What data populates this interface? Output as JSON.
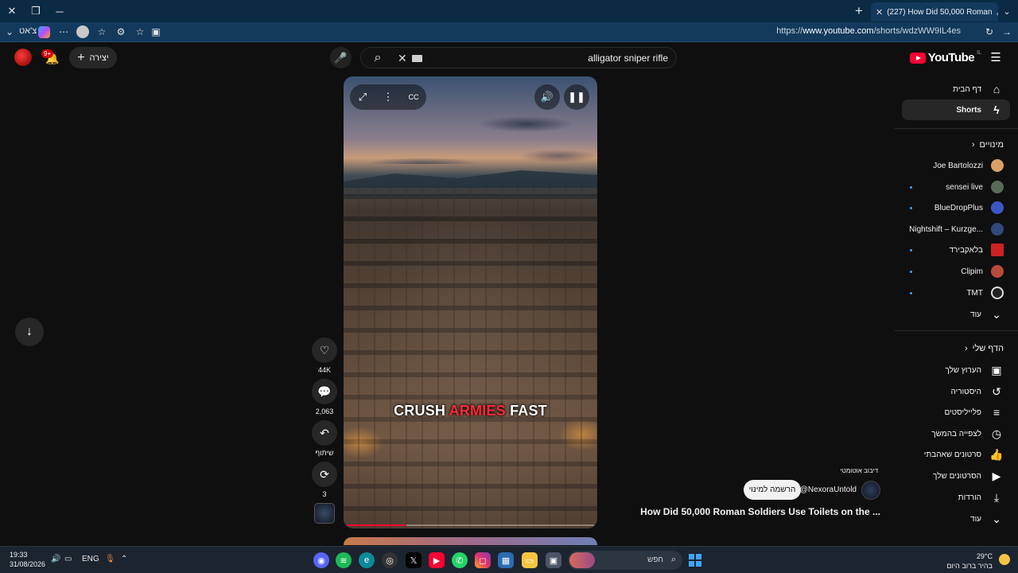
{
  "browser": {
    "tab_title": "(227) How Did 50,000 Roman",
    "url_prefix": "https://",
    "url_domain": "www.youtube.com",
    "url_path": "/shorts/wdzWW9IL4es",
    "chat_label": "צ'אט"
  },
  "header": {
    "logo_text": "YouTube",
    "logo_country": "IL",
    "search_query": "alligator sniper rifle",
    "create_label": "יצירה",
    "notif_count": "9+"
  },
  "sidebar": {
    "home": "דף הבית",
    "shorts": "Shorts",
    "subs_heading": "מינויים",
    "subscriptions": [
      "Joe Bartolozzi",
      "sensei live",
      "BlueDropPlus",
      "Nightshift – Kurzge...",
      "בלאקבירד",
      "Clipim",
      "TMT"
    ],
    "more": "עוד",
    "you_heading": "הדף שלי",
    "you_items": [
      "הערוץ שלך",
      "היסטוריה",
      "פלייליסטים",
      "לצפייה בהמשך",
      "סרטונים שאהבתי",
      "הסרטונים שלך",
      "הורדות"
    ],
    "more2": "עוד"
  },
  "video": {
    "caption_part1": "CRUSH ",
    "caption_highlight": "ARMIES",
    "caption_part2": " FAST",
    "likes": "44K",
    "comments": "2,063",
    "share_label": "שיתוף",
    "remix_count": "3",
    "dub_tag": "דיבוב אוטומטי",
    "channel": "@NexoraUntold",
    "subscribe_label": "הרשמה למינוי",
    "title": "How Did 50,000 Roman Soldiers Use Toilets on the ...",
    "progress_fraction": 0.24
  },
  "taskbar": {
    "time": "19:33",
    "date": "31/08/2026",
    "lang": "ENG",
    "search_label": "חפש",
    "temp": "29°C",
    "weather_desc": "בהיר ברוב היום"
  },
  "colors": {
    "brand": "#ff0033",
    "bg": "#0f0f0f",
    "accent": "#3ea6ff"
  }
}
